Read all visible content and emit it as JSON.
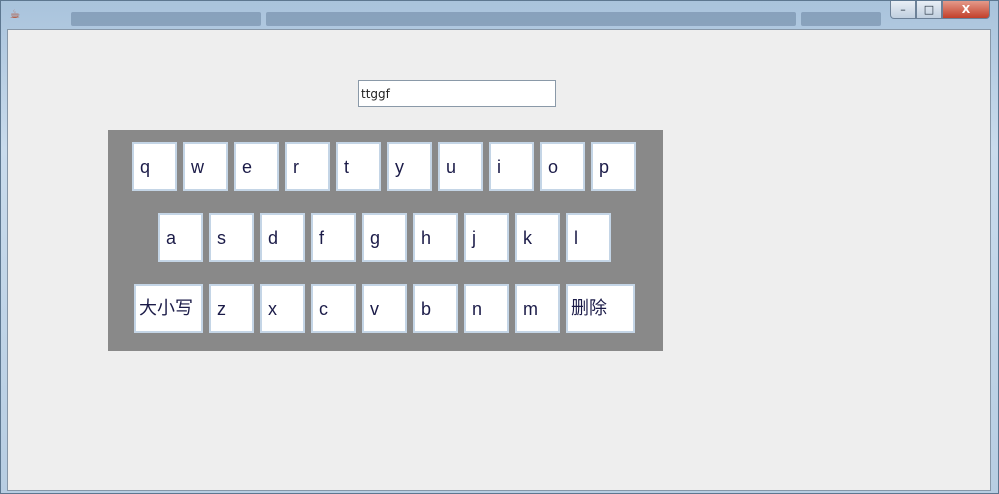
{
  "window": {
    "app_icon": "java-icon",
    "minimize_glyph": "–",
    "maximize_glyph": "□",
    "close_glyph": "X"
  },
  "input": {
    "value": "ttggf"
  },
  "keyboard": {
    "row1": [
      "q",
      "w",
      "e",
      "r",
      "t",
      "y",
      "u",
      "i",
      "o",
      "p"
    ],
    "row2": [
      "a",
      "s",
      "d",
      "f",
      "g",
      "h",
      "j",
      "k",
      "l"
    ],
    "row3": [
      "大小写",
      "z",
      "x",
      "c",
      "v",
      "b",
      "n",
      "m",
      "删除"
    ]
  }
}
